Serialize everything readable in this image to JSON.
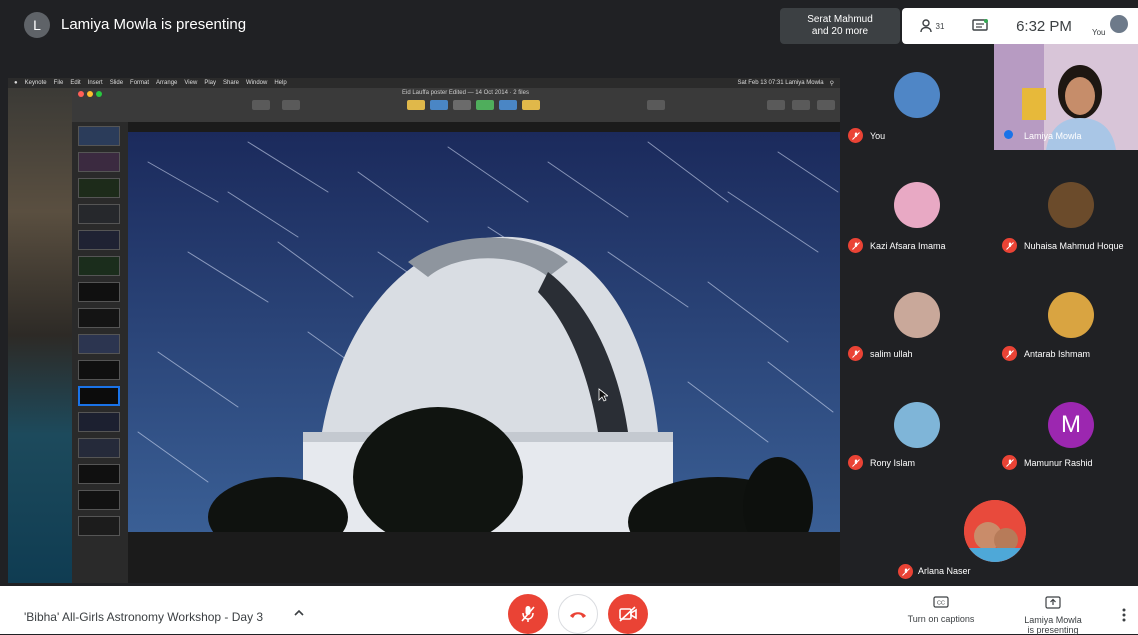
{
  "topbar": {
    "presenter_initial": "L",
    "presenter_title": "Lamiya Mowla is presenting",
    "others_line1": "Serat Mahmud",
    "others_line2": "and 20 more",
    "people_count": "31",
    "clock": "6:32 PM",
    "you_label": "You"
  },
  "shared_screen": {
    "mac_menu": [
      "Keynote",
      "File",
      "Edit",
      "Insert",
      "Slide",
      "Format",
      "Arrange",
      "View",
      "Play",
      "Share",
      "Window",
      "Help"
    ],
    "mac_status": "Sat Feb 13 07:31   Lamiya Mowla",
    "doc_title": "Eid Lauffa poster  Edited — 14 Oct 2014 · 2 files"
  },
  "participants": [
    {
      "name": "You",
      "avatar_color": "#4f86c6"
    },
    {
      "name": "Lamiya Mowla",
      "avatar_color": "#d7b6cf"
    },
    {
      "name": "Kazi Afsara Imama",
      "avatar_color": "#e8a9c4"
    },
    {
      "name": "Nuhaisa Mahmud Hoque",
      "avatar_color": "#6b4b2b"
    },
    {
      "name": "salim ullah",
      "avatar_color": "#c9a89a"
    },
    {
      "name": "Antarab Ishmam",
      "avatar_color": "#d9a441"
    },
    {
      "name": "Rony Islam",
      "avatar_color": "#7fb5d8"
    },
    {
      "name": "Mamunur Rashid",
      "avatar_initial": "M",
      "avatar_color": "#9c27b0"
    },
    {
      "name": "Arlana Naser",
      "avatar_color": "#e84a3c"
    }
  ],
  "bottombar": {
    "meeting_title": "'Bibha' All-Girls Astronomy Workshop - Day 3",
    "captions_label": "Turn on captions",
    "present_label_line1": "Lamiya Mowla",
    "present_label_line2": "is presenting"
  },
  "colors": {
    "danger": "#ea4335",
    "background": "#202124",
    "accent": "#1a73e8"
  }
}
